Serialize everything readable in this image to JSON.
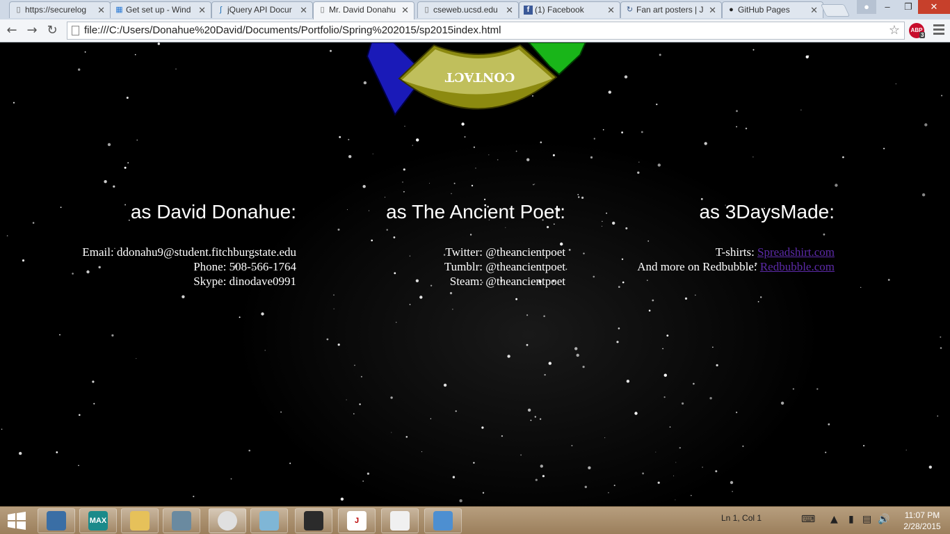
{
  "browser": {
    "tabs": [
      {
        "title": "https://securelog",
        "icon": "document-icon"
      },
      {
        "title": "Get set up - Wind",
        "icon": "windows-icon"
      },
      {
        "title": "jQuery API Docur",
        "icon": "jquery-icon"
      },
      {
        "title": "Mr. David Donahu",
        "icon": "document-icon",
        "active": true
      },
      {
        "title": "cseweb.ucsd.edu",
        "icon": "document-icon"
      },
      {
        "title": "(1) Facebook",
        "icon": "facebook-icon"
      },
      {
        "title": "Fan art posters | J",
        "icon": "refresh-icon"
      },
      {
        "title": "GitHub Pages",
        "icon": "github-icon"
      }
    ],
    "address_url": "file:///C:/Users/Donahue%20David/Documents/Portfolio/Spring%202015/sp2015index.html",
    "abp_label": "ABP",
    "abp_count": "3"
  },
  "page": {
    "nav_ring_label": "CONTACT",
    "columns": [
      {
        "heading": "as David Donahue:",
        "lines": [
          {
            "text": "Email: ddonahu9@student.fitchburgstate.edu"
          },
          {
            "text": "Phone: 508-566-1764"
          },
          {
            "text": "Skype: dinodave0991"
          }
        ]
      },
      {
        "heading": "as The Ancient Poet:",
        "lines": [
          {
            "text": "Twitter: @theancientpoet"
          },
          {
            "text": "Tumblr: @theancientpoet"
          },
          {
            "text": "Steam: @theancientpoet"
          }
        ]
      },
      {
        "heading": "as 3DaysMade:",
        "lines": [
          {
            "label": "T-shirts: ",
            "link": "Spreadshirt.com"
          },
          {
            "label": "And more on Redbubble: ",
            "link": "Redbubble.com"
          }
        ]
      }
    ]
  },
  "taskbar": {
    "status": "Ln 1, Col 1",
    "time": "11:07 PM",
    "date": "2/28/2015",
    "apps": [
      {
        "name": "python-icon",
        "label": "",
        "color": "#3a6ea5"
      },
      {
        "name": "3dsmax-icon",
        "label": "MAX",
        "color": "#1a8a8a"
      },
      {
        "name": "folder-icon",
        "label": "",
        "color": "#e6c15a"
      },
      {
        "name": "network-icon",
        "label": "",
        "color": "#6a8aa0"
      },
      {
        "name": "chrome-icon",
        "label": "",
        "color": "#e0e0e0"
      },
      {
        "name": "notepad-icon",
        "label": "",
        "color": "#7fb6d6"
      },
      {
        "name": "media-player-icon",
        "label": "",
        "color": "#2b2b2b"
      },
      {
        "name": "jgrasp-icon",
        "label": "J",
        "color": "#ffffff"
      },
      {
        "name": "java-icon",
        "label": "",
        "color": "#f0f0f0"
      },
      {
        "name": "photo-viewer-icon",
        "label": "",
        "color": "#4d8fd1"
      }
    ]
  }
}
